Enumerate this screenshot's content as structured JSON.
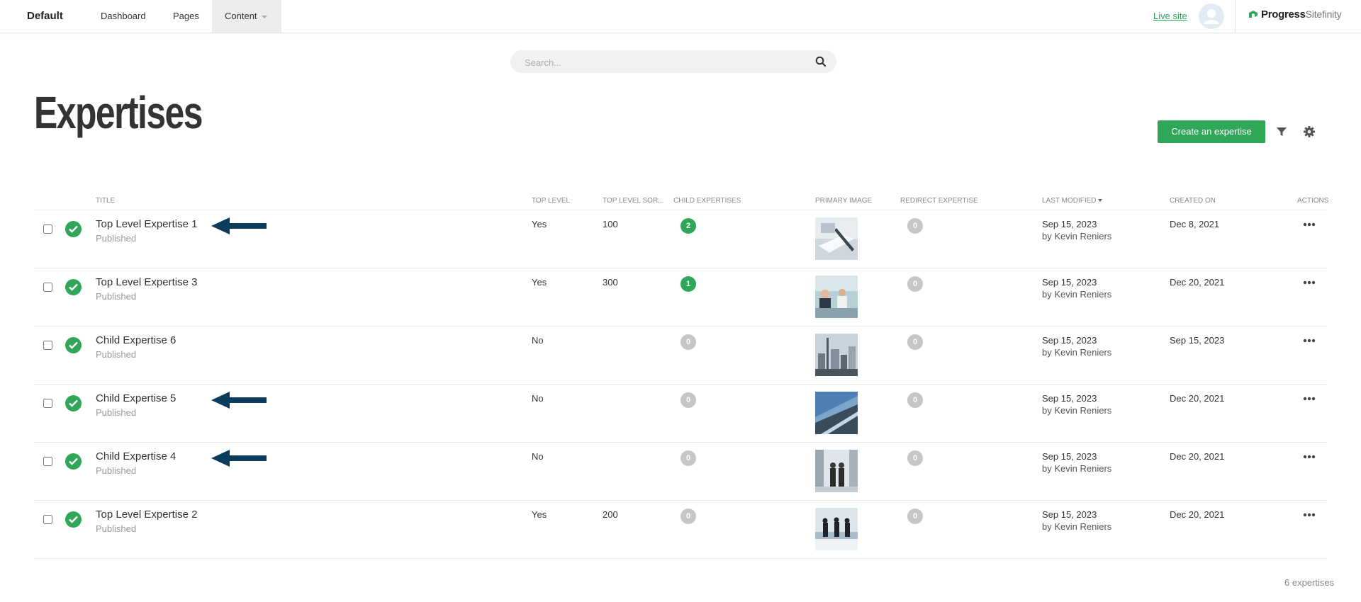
{
  "topbar": {
    "site_name": "Default",
    "nav": [
      "Dashboard",
      "Pages",
      "Content"
    ],
    "live_site": "Live site",
    "brand_primary": "Progress",
    "brand_secondary": "Sitefinity",
    "brand_color": "#2fa658"
  },
  "search": {
    "placeholder": "Search..."
  },
  "page": {
    "title": "Expertises",
    "create_button": "Create an expertise",
    "accent_color": "#2fa658"
  },
  "table": {
    "headers": {
      "title": "TITLE",
      "top_level": "TOP LEVEL",
      "top_level_sort": "TOP LEVEL SOR...",
      "child_expertises": "CHILD EXPERTISES",
      "primary_image": "PRIMARY IMAGE",
      "redirect_expertise": "REDIRECT EXPERTISE",
      "last_modified": "LAST MODIFIED",
      "created_on": "CREATED ON",
      "actions": "ACTIONS"
    },
    "rows": [
      {
        "title": "Top Level Expertise 1",
        "status": "Published",
        "top_level": "Yes",
        "sort": "100",
        "children": "2",
        "redirect": "0",
        "modified_date": "Sep 15, 2023",
        "modified_by": "by Kevin Reniers",
        "created": "Dec 8, 2021",
        "arrow": true,
        "image": "office-pen-photo"
      },
      {
        "title": "Top Level Expertise 3",
        "status": "Published",
        "top_level": "Yes",
        "sort": "300",
        "children": "1",
        "redirect": "0",
        "modified_date": "Sep 15, 2023",
        "modified_by": "by Kevin Reniers",
        "created": "Dec 20, 2021",
        "arrow": false,
        "image": "office-meeting-photo"
      },
      {
        "title": "Child Expertise 6",
        "status": "Published",
        "top_level": "No",
        "sort": "",
        "children": "0",
        "redirect": "0",
        "modified_date": "Sep 15, 2023",
        "modified_by": "by Kevin Reniers",
        "created": "Sep 15, 2023",
        "arrow": false,
        "image": "city-skyline-photo"
      },
      {
        "title": "Child Expertise 5",
        "status": "Published",
        "top_level": "No",
        "sort": "",
        "children": "0",
        "redirect": "0",
        "modified_date": "Sep 15, 2023",
        "modified_by": "by Kevin Reniers",
        "created": "Dec 20, 2021",
        "arrow": true,
        "image": "glass-building-photo"
      },
      {
        "title": "Child Expertise 4",
        "status": "Published",
        "top_level": "No",
        "sort": "",
        "children": "0",
        "redirect": "0",
        "modified_date": "Sep 15, 2023",
        "modified_by": "by Kevin Reniers",
        "created": "Dec 20, 2021",
        "arrow": true,
        "image": "handshake-photo"
      },
      {
        "title": "Top Level Expertise 2",
        "status": "Published",
        "top_level": "Yes",
        "sort": "200",
        "children": "0",
        "redirect": "0",
        "modified_date": "Sep 15, 2023",
        "modified_by": "by Kevin Reniers",
        "created": "Dec 20, 2021",
        "arrow": false,
        "image": "business-silhouettes-photo"
      }
    ]
  },
  "footer": {
    "count": "6 expertises"
  }
}
